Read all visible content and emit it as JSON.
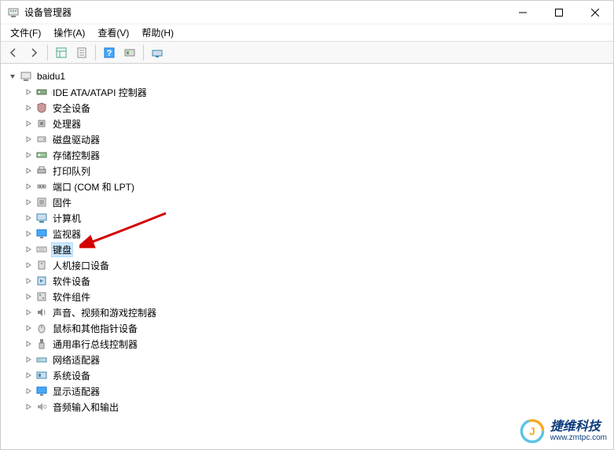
{
  "window": {
    "title": "设备管理器"
  },
  "menu": {
    "file": "文件(F)",
    "action": "操作(A)",
    "view": "查看(V)",
    "help": "帮助(H)"
  },
  "tree": {
    "root": "baidu1",
    "items": [
      {
        "label": "IDE ATA/ATAPI 控制器",
        "icon": "ide"
      },
      {
        "label": "安全设备",
        "icon": "security"
      },
      {
        "label": "处理器",
        "icon": "cpu"
      },
      {
        "label": "磁盘驱动器",
        "icon": "disk"
      },
      {
        "label": "存储控制器",
        "icon": "storage"
      },
      {
        "label": "打印队列",
        "icon": "printer"
      },
      {
        "label": "端口 (COM 和 LPT)",
        "icon": "port"
      },
      {
        "label": "固件",
        "icon": "firmware"
      },
      {
        "label": "计算机",
        "icon": "computer"
      },
      {
        "label": "监视器",
        "icon": "monitor"
      },
      {
        "label": "键盘",
        "icon": "keyboard",
        "selected": true
      },
      {
        "label": "人机接口设备",
        "icon": "hid"
      },
      {
        "label": "软件设备",
        "icon": "software"
      },
      {
        "label": "软件组件",
        "icon": "component"
      },
      {
        "label": "声音、视频和游戏控制器",
        "icon": "audio"
      },
      {
        "label": "鼠标和其他指针设备",
        "icon": "mouse"
      },
      {
        "label": "通用串行总线控制器",
        "icon": "usb"
      },
      {
        "label": "网络适配器",
        "icon": "network"
      },
      {
        "label": "系统设备",
        "icon": "system"
      },
      {
        "label": "显示适配器",
        "icon": "display"
      },
      {
        "label": "音频输入和输出",
        "icon": "audioio"
      }
    ]
  },
  "watermark": {
    "brand": "捷维科技",
    "url": "www.zmtpc.com"
  }
}
